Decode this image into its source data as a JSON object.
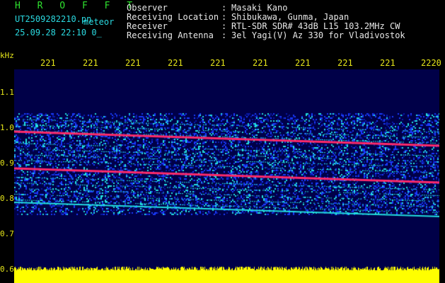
{
  "header": {
    "title": "H R O F F T",
    "file_name": "UT2509282210.pn",
    "file_suffix": "meteor",
    "file_date": "25.09.28 22:10    0_"
  },
  "metadata": [
    {
      "label": "Observer",
      "value": "Masaki Kano"
    },
    {
      "label": "Receiving Location",
      "value": "Shibukawa, Gunma, Japan"
    },
    {
      "label": "Receiver",
      "value": "RTL-SDR SDR# 43dB L15 103.2MHz CW"
    },
    {
      "label": "Receiving Antenna",
      "value": "3el Yagi(V) Az 330 for Vladivostok"
    }
  ],
  "axis": {
    "unit_label": "kHz",
    "x_ticks": [
      "221",
      "221",
      "221",
      "221",
      "221",
      "221",
      "221",
      "221",
      "221",
      "2220"
    ],
    "y_ticks": [
      "1.1",
      "1.0",
      "0.9",
      "0.8",
      "0.7",
      "0.6"
    ]
  },
  "colors": {
    "background": "#000000",
    "plot_bg": "#000048",
    "trace": "#ff2a6a",
    "noise_low": "#1a3cff",
    "noise_high": "#22e0e0",
    "power_bar": "#ffff00"
  }
}
